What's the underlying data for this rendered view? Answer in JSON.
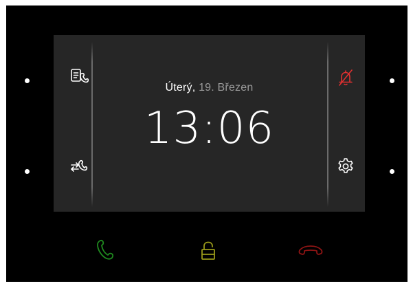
{
  "status": {
    "day": "Úterý,",
    "date_rest": "19. Březen",
    "time": "13:06"
  },
  "icons": {
    "top_left": "contacts-phone-icon",
    "bottom_left": "call-forward-icon",
    "top_right": "bell-muted-icon",
    "bottom_right": "settings-gear-icon",
    "call": "phone-answer-icon",
    "unlock": "padlock-open-icon",
    "hangup": "phone-hangup-icon"
  },
  "colors": {
    "mute_red": "#e03030",
    "answer_green": "#1f8a1f",
    "unlock_yellow": "#9a9a1a",
    "hangup_red": "#8e1414"
  }
}
